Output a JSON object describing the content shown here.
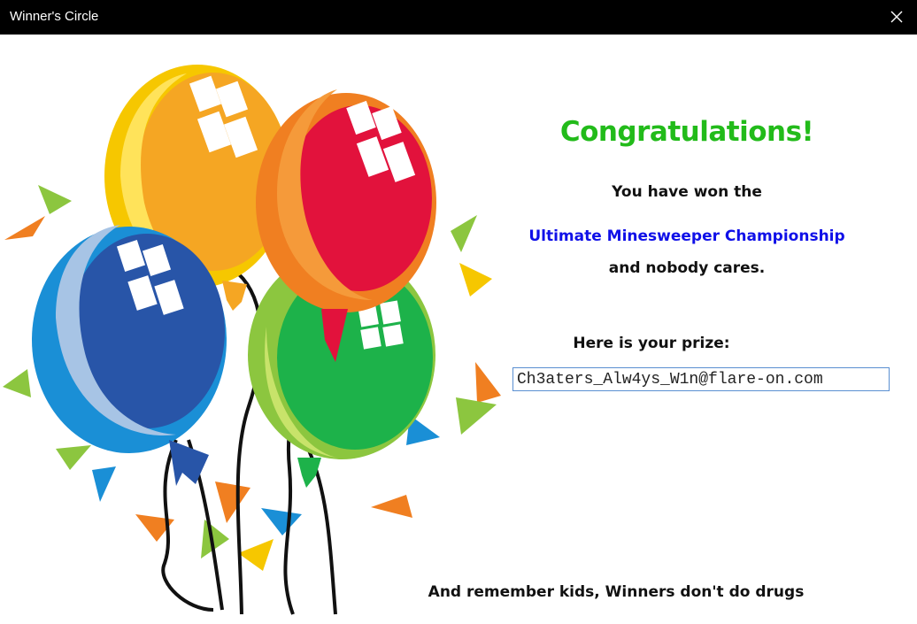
{
  "window": {
    "title": "Winner's Circle",
    "close_icon": "close-icon"
  },
  "content": {
    "heading": "Congratulations!",
    "line1": "You have won the",
    "line2": "Ultimate Minesweeper Championship",
    "line3": "and nobody cares.",
    "prize_label": "Here is your prize:",
    "prize_value": "Ch3aters_Alw4ys_W1n@flare-on.com",
    "footer": "And remember kids, Winners don't do drugs"
  },
  "colors": {
    "heading": "#22bb1a",
    "championship": "#1010e8",
    "titlebar": "#000000"
  },
  "illustration": "balloons-and-confetti"
}
